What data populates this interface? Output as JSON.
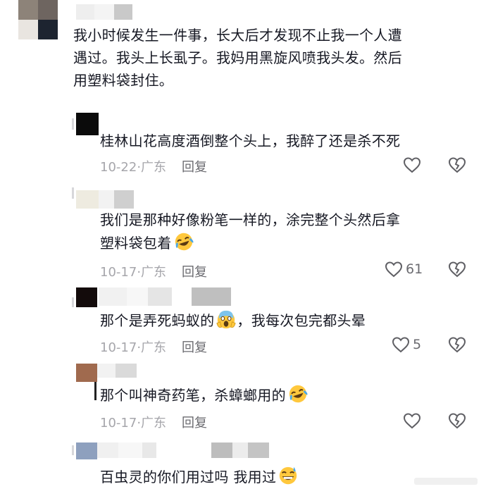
{
  "thread": {
    "main_comment": {
      "lines": [
        "我小时候发生一件事，长大后才发现不止我一个人遭",
        "遇过。我头上长虱子。我妈用黑旋风喷我头发。然后",
        "用塑料袋封住。"
      ]
    },
    "replies": [
      {
        "lines": [
          "桂林山花高度酒倒整个头上，我醉了还是杀不死"
        ],
        "date": "10-22",
        "region": "广东",
        "reply_label": "回复",
        "likes": "",
        "emoji": ""
      },
      {
        "lines": [
          "我们是那种好像粉笔一样的，涂完整个头然后拿",
          "塑料袋包着"
        ],
        "date": "10-17",
        "region": "广东",
        "reply_label": "回复",
        "likes": "61",
        "emoji": "laughing-tears"
      },
      {
        "lines": [
          "那个是弄死蚂蚁的",
          "，我每次包完都头晕"
        ],
        "date": "10-17",
        "region": "广东",
        "reply_label": "回复",
        "likes": "5",
        "emoji": "screaming"
      },
      {
        "lines": [
          "那个叫神奇药笔，杀蟑螂用的"
        ],
        "date": "10-17",
        "region": "广东",
        "reply_label": "回复",
        "likes": "",
        "emoji": "laughing-tears"
      },
      {
        "lines": [
          "百虫灵的你们用过吗 我用过"
        ],
        "emoji": "grin-sweat"
      }
    ]
  },
  "icons": {
    "like": "heart-outline-icon",
    "dislike": "broken-heart-icon"
  },
  "colors": {
    "text": "#161823",
    "meta": "#a6a6ab",
    "icon": "#6b6b70",
    "emoji_face": "#ffc83d",
    "emoji_tear": "#4aa8e8"
  }
}
